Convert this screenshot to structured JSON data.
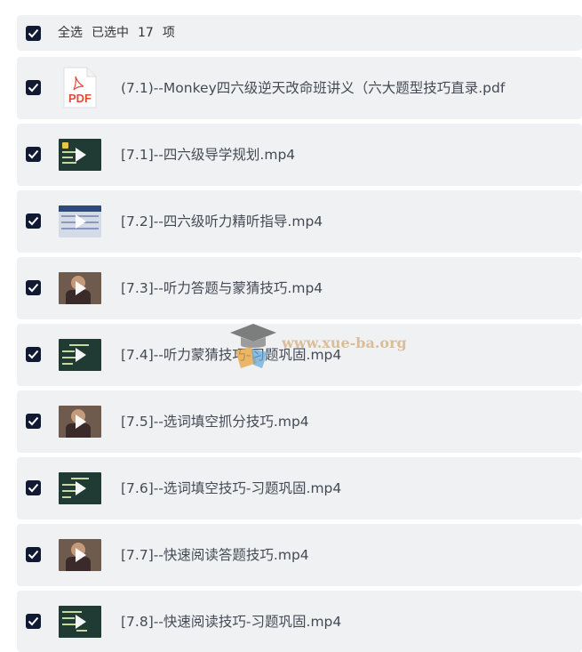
{
  "header": {
    "select_all_label": "全选",
    "selected_prefix": "已选中",
    "selected_count": "17",
    "selected_suffix": "项"
  },
  "files": [
    {
      "name": "(7.1)--Monkey四六级逆天改命班讲义（六大题型技巧直录.pdf",
      "type": "pdf",
      "icon_label": "PDF"
    },
    {
      "name": "[7.1]--四六级导学规划.mp4",
      "type": "video",
      "thumb": "dark"
    },
    {
      "name": "[7.2]--四六级听力精听指导.mp4",
      "type": "video",
      "thumb": "table"
    },
    {
      "name": "[7.3]--听力答题与蒙猜技巧.mp4",
      "type": "video",
      "thumb": "person"
    },
    {
      "name": "[7.4]--听力蒙猜技巧-习题巩固.mp4",
      "type": "video",
      "thumb": "dark"
    },
    {
      "name": "[7.5]--选词填空抓分技巧.mp4",
      "type": "video",
      "thumb": "person"
    },
    {
      "name": "[7.6]--选词填空技巧-习题巩固.mp4",
      "type": "video",
      "thumb": "dark"
    },
    {
      "name": "[7.7]--快速阅读答题技巧.mp4",
      "type": "video",
      "thumb": "person"
    },
    {
      "name": "[7.8]--快速阅读技巧-习题巩固.mp4",
      "type": "video",
      "thumb": "dark"
    }
  ],
  "watermark": {
    "text": "www.xue-ba.org"
  },
  "colors": {
    "row_bg": "#f0f1f3",
    "checkbox": "#111a33",
    "pdf_red": "#e5493a"
  }
}
